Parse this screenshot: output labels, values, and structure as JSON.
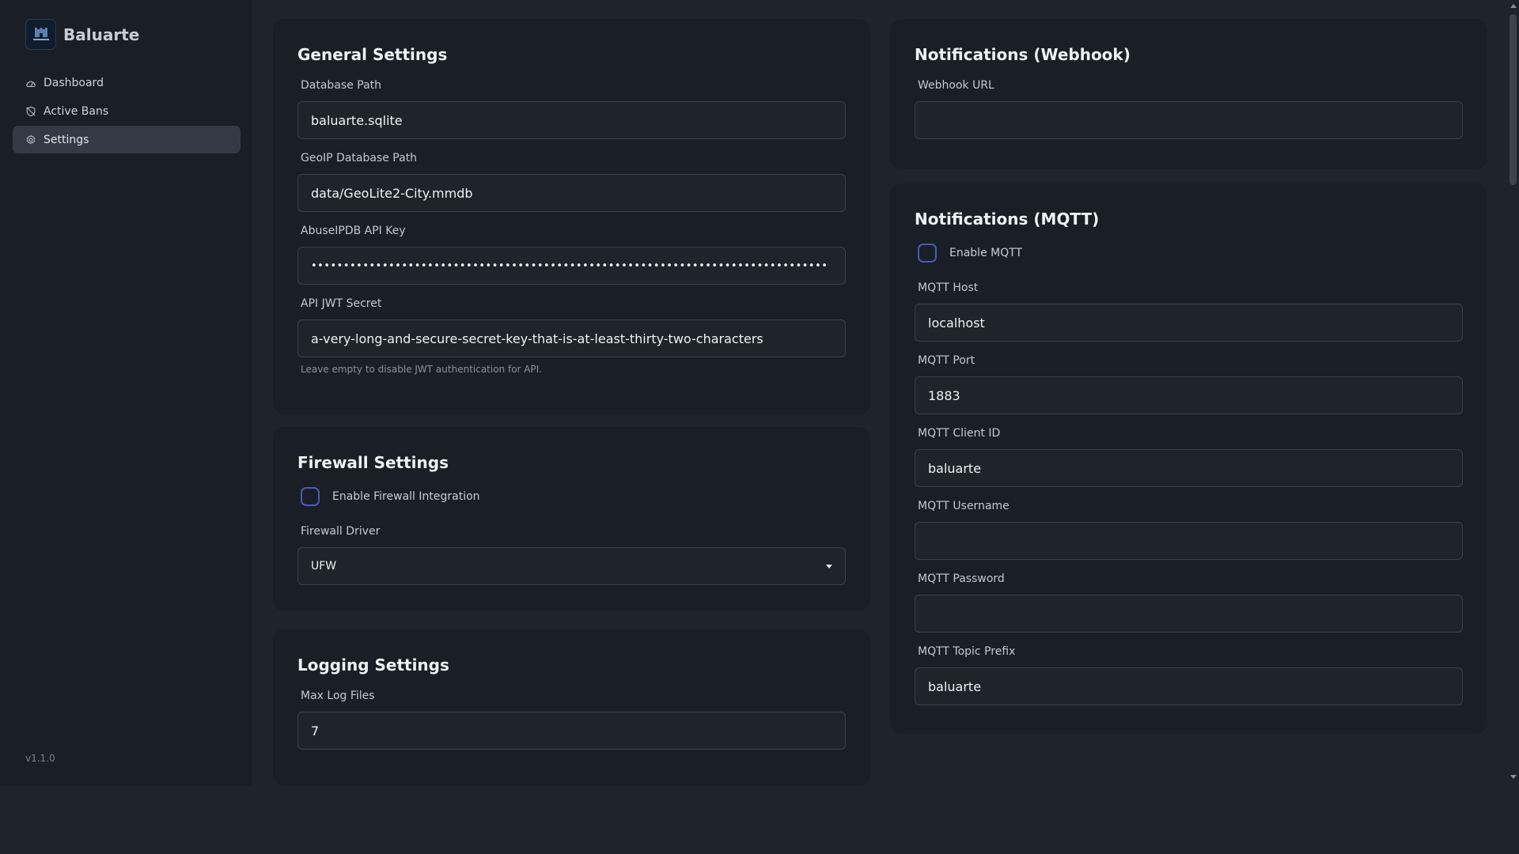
{
  "app": {
    "name": "Baluarte",
    "version": "v1.1.0"
  },
  "sidebar": {
    "items": [
      {
        "label": "Dashboard",
        "icon": "dashboard-icon"
      },
      {
        "label": "Active Bans",
        "icon": "shield-off-icon"
      },
      {
        "label": "Settings",
        "icon": "gear-icon",
        "active": true
      }
    ]
  },
  "general": {
    "title": "General Settings",
    "db_path_label": "Database Path",
    "db_path_value": "baluarte.sqlite",
    "geoip_label": "GeoIP Database Path",
    "geoip_value": "data/GeoLite2-City.mmdb",
    "abuse_label": "AbuseIPDB API Key",
    "abuse_value": "••••••••••••••••••••••••••••••••••••••••••••••••••••••••••••••••••••••••••••••••",
    "jwt_label": "API JWT Secret",
    "jwt_value": "a-very-long-and-secure-secret-key-that-is-at-least-thirty-two-characters",
    "jwt_help": "Leave empty to disable JWT authentication for API."
  },
  "firewall": {
    "title": "Firewall Settings",
    "enable_label": "Enable Firewall Integration",
    "enabled": false,
    "driver_label": "Firewall Driver",
    "driver_value": "UFW"
  },
  "logging": {
    "title": "Logging Settings",
    "max_files_label": "Max Log Files",
    "max_files_value": "7"
  },
  "webhook": {
    "title": "Notifications (Webhook)",
    "url_label": "Webhook URL",
    "url_value": ""
  },
  "mqtt": {
    "title": "Notifications (MQTT)",
    "enable_label": "Enable MQTT",
    "enabled": false,
    "host_label": "MQTT Host",
    "host_value": "localhost",
    "port_label": "MQTT Port",
    "port_value": "1883",
    "client_label": "MQTT Client ID",
    "client_value": "baluarte",
    "username_label": "MQTT Username",
    "username_value": "",
    "password_label": "MQTT Password",
    "password_value": "",
    "topic_label": "MQTT Topic Prefix",
    "topic_value": "baluarte"
  },
  "colors": {
    "background": "#1f242c",
    "card": "#1a1e26",
    "checkbox_border": "#4b5bb5",
    "active_nav": "#343a45"
  }
}
